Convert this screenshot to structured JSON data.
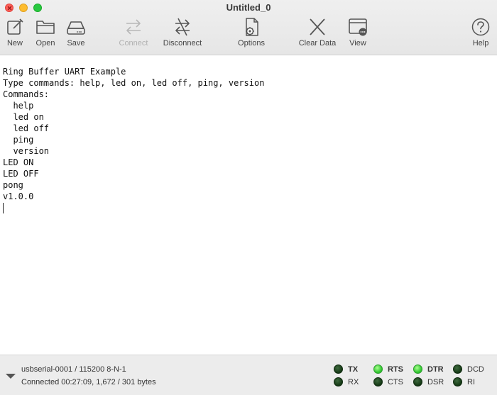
{
  "window": {
    "title": "Untitled_0"
  },
  "toolbar": {
    "new_label": "New",
    "open_label": "Open",
    "save_label": "Save",
    "connect_label": "Connect",
    "disconnect_label": "Disconnect",
    "options_label": "Options",
    "clear_label": "Clear Data",
    "view_label": "View",
    "help_label": "Help"
  },
  "terminal": {
    "lines": [
      "Ring Buffer UART Example",
      "Type commands: help, led on, led off, ping, version",
      "Commands:",
      "  help",
      "  led on",
      "  led off",
      "  ping",
      "  version",
      "LED ON",
      "LED OFF",
      "pong",
      "v1.0.0"
    ]
  },
  "status": {
    "port_info": "usbserial-0001 / 115200 8-N-1",
    "connection": "Connected 00:27:09, 1,672 / 301 bytes",
    "indicators": {
      "tx": {
        "label": "TX",
        "on": false
      },
      "rx": {
        "label": "RX",
        "on": false
      },
      "rts": {
        "label": "RTS",
        "on": true
      },
      "cts": {
        "label": "CTS",
        "on": false
      },
      "dtr": {
        "label": "DTR",
        "on": true
      },
      "dsr": {
        "label": "DSR",
        "on": false
      },
      "dcd": {
        "label": "DCD",
        "on": false
      },
      "ri": {
        "label": "RI",
        "on": false
      }
    }
  },
  "colors": {
    "led_on": "#2ec52e",
    "led_off": "#143814",
    "close": "#fe5f57",
    "minimize": "#febc2e",
    "zoom": "#28c840"
  }
}
